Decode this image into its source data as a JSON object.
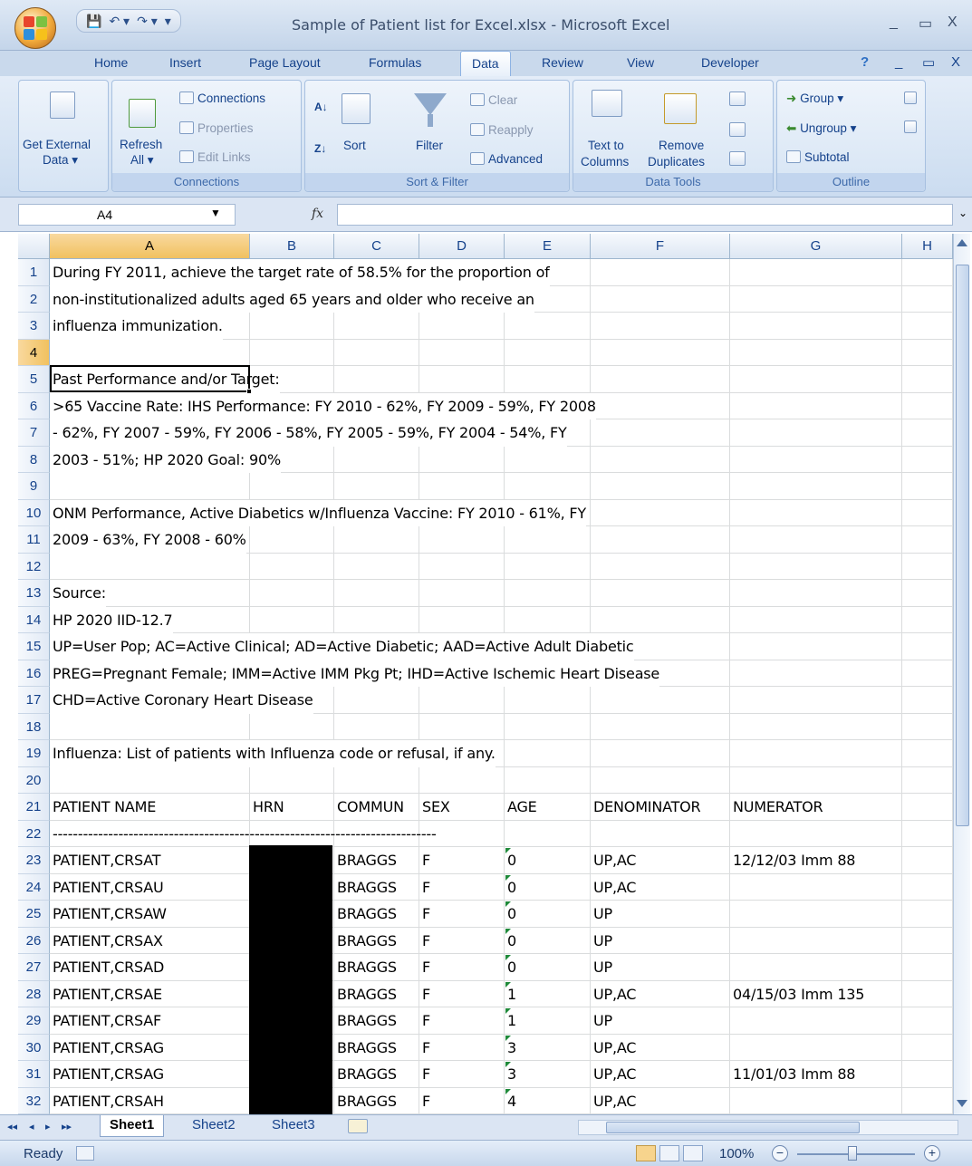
{
  "window": {
    "title": "Sample of Patient list for Excel.xlsx - Microsoft Excel",
    "qat": [
      "💾",
      "↶ ▾",
      "↷ ▾",
      "▾"
    ],
    "controls": [
      "_",
      "▭",
      "X"
    ]
  },
  "ribbon": {
    "tabs": [
      "Home",
      "Insert",
      "Page Layout",
      "Formulas",
      "Data",
      "Review",
      "View",
      "Developer"
    ],
    "active_tab": "Data",
    "help_icon": "?",
    "mdi_controls": [
      "_",
      "▭",
      "X"
    ],
    "groups": {
      "get_external": {
        "line1": "Get External",
        "line2": "Data ▾"
      },
      "connections": {
        "label": "Connections",
        "refresh_line1": "Refresh",
        "refresh_line2": "All ▾",
        "items": [
          "Connections",
          "Properties",
          "Edit Links"
        ]
      },
      "sort_filter": {
        "label": "Sort & Filter",
        "az": "A↓",
        "za": "Z↓",
        "sort": "Sort",
        "filter": "Filter",
        "items": [
          "Clear",
          "Reapply",
          "Advanced"
        ]
      },
      "data_tools": {
        "label": "Data Tools",
        "text_to_columns_1": "Text to",
        "text_to_columns_2": "Columns",
        "remove_dup_1": "Remove",
        "remove_dup_2": "Duplicates"
      },
      "outline": {
        "label": "Outline",
        "items": [
          "Group ▾",
          "Ungroup ▾",
          "Subtotal"
        ]
      }
    }
  },
  "formula_bar": {
    "name_box": "A4",
    "fx": "fx",
    "value": ""
  },
  "grid": {
    "columns": [
      "A",
      "B",
      "C",
      "D",
      "E",
      "F",
      "G",
      "H"
    ],
    "selected_column": "A",
    "selected_row": "4",
    "rows": [
      {
        "n": "1",
        "text": "During FY 2011, achieve the target rate of 58.5% for the proportion of"
      },
      {
        "n": "2",
        "text": "non-institutionalized adults aged 65 years and older who receive an"
      },
      {
        "n": "3",
        "text": "influenza immunization."
      },
      {
        "n": "4",
        "text": ""
      },
      {
        "n": "5",
        "text": "Past Performance and/or Target:"
      },
      {
        "n": "6",
        "text": ">65 Vaccine Rate: IHS Performance:  FY 2010 - 62%, FY 2009 - 59%, FY 2008"
      },
      {
        "n": "7",
        "text": "- 62%, FY 2007 - 59%, FY 2006 - 58%, FY 2005 - 59%, FY 2004 - 54%, FY"
      },
      {
        "n": "8",
        "text": "2003 - 51%; HP 2020 Goal: 90%"
      },
      {
        "n": "9",
        "text": ""
      },
      {
        "n": "10",
        "text": "ONM Performance, Active Diabetics w/Influenza Vaccine:  FY 2010 - 61%, FY"
      },
      {
        "n": "11",
        "text": "2009 - 63%, FY 2008 - 60%"
      },
      {
        "n": "12",
        "text": ""
      },
      {
        "n": "13",
        "text": "Source:"
      },
      {
        "n": "14",
        "text": "HP 2020 IID-12.7"
      },
      {
        "n": "15",
        "text": "UP=User Pop; AC=Active Clinical; AD=Active Diabetic; AAD=Active Adult Diabetic"
      },
      {
        "n": "16",
        "text": "PREG=Pregnant Female; IMM=Active IMM Pkg Pt; IHD=Active Ischemic Heart Disease"
      },
      {
        "n": "17",
        "text": "CHD=Active Coronary Heart Disease"
      },
      {
        "n": "18",
        "text": ""
      },
      {
        "n": "19",
        "text": "Influenza: List of patients with Influenza code or refusal, if any."
      },
      {
        "n": "20",
        "text": ""
      }
    ],
    "header_row": {
      "n": "21",
      "cells": [
        "PATIENT NAME",
        "HRN",
        "COMMUN",
        "SEX",
        "AGE",
        "DENOMINATOR",
        "NUMERATOR"
      ]
    },
    "dash_row": {
      "n": "22",
      "text": "----------------------------------------------------------------------------"
    },
    "patients": [
      {
        "n": "23",
        "name": "PATIENT,CRSAT",
        "commun": "BRAGGS",
        "sex": "F",
        "age": "0",
        "denominator": "UP,AC",
        "numerator": "12/12/03 Imm 88"
      },
      {
        "n": "24",
        "name": "PATIENT,CRSAU",
        "commun": "BRAGGS",
        "sex": "F",
        "age": "0",
        "denominator": "UP,AC",
        "numerator": ""
      },
      {
        "n": "25",
        "name": "PATIENT,CRSAW",
        "commun": "BRAGGS",
        "sex": "F",
        "age": "0",
        "denominator": "UP",
        "numerator": ""
      },
      {
        "n": "26",
        "name": "PATIENT,CRSAX",
        "commun": "BRAGGS",
        "sex": "F",
        "age": "0",
        "denominator": "UP",
        "numerator": ""
      },
      {
        "n": "27",
        "name": "PATIENT,CRSAD",
        "commun": "BRAGGS",
        "sex": "F",
        "age": "0",
        "denominator": "UP",
        "numerator": ""
      },
      {
        "n": "28",
        "name": "PATIENT,CRSAE",
        "commun": "BRAGGS",
        "sex": "F",
        "age": "1",
        "denominator": "UP,AC",
        "numerator": "04/15/03 Imm 135"
      },
      {
        "n": "29",
        "name": "PATIENT,CRSAF",
        "commun": "BRAGGS",
        "sex": "F",
        "age": "1",
        "denominator": "UP",
        "numerator": ""
      },
      {
        "n": "30",
        "name": "PATIENT,CRSAG",
        "commun": "BRAGGS",
        "sex": "F",
        "age": "3",
        "denominator": "UP,AC",
        "numerator": ""
      },
      {
        "n": "31",
        "name": "PATIENT,CRSAG",
        "commun": "BRAGGS",
        "sex": "F",
        "age": "3",
        "denominator": "UP,AC",
        "numerator": "11/01/03 Imm 88"
      },
      {
        "n": "32",
        "name": "PATIENT,CRSAH",
        "commun": "BRAGGS",
        "sex": "F",
        "age": "4",
        "denominator": "UP,AC",
        "numerator": ""
      }
    ]
  },
  "sheets": {
    "nav": [
      "◂◂",
      "◂",
      "▸",
      "▸▸"
    ],
    "tabs": [
      "Sheet1",
      "Sheet2",
      "Sheet3"
    ],
    "active": "Sheet1"
  },
  "status": {
    "text": "Ready",
    "zoom": "100%",
    "zoom_minus": "−",
    "zoom_plus": "+"
  },
  "colors": {
    "selection_highlight": "#f1c15f",
    "ribbon_text": "#15428b",
    "error_triangle": "#1f8a3a"
  }
}
